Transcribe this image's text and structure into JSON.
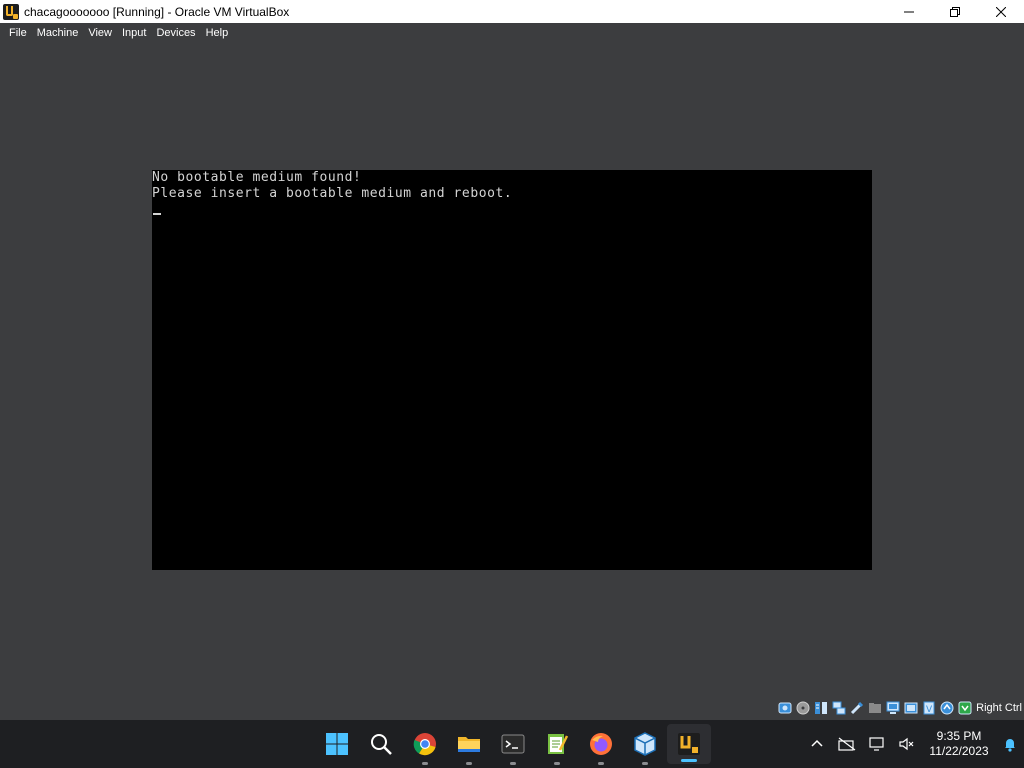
{
  "window": {
    "title": "chacagooooooo [Running] - Oracle VM VirtualBox"
  },
  "menu": {
    "items": [
      {
        "label": "File"
      },
      {
        "label": "Machine"
      },
      {
        "label": "View"
      },
      {
        "label": "Input"
      },
      {
        "label": "Devices"
      },
      {
        "label": "Help"
      }
    ]
  },
  "vm_screen": {
    "line1": "No bootable medium found!",
    "line2": "Please insert a bootable medium and reboot."
  },
  "statusbar": {
    "host_key": "Right Ctrl",
    "icons": [
      "hard-disk-icon",
      "optical-drive-icon",
      "audio-icon",
      "network-icon",
      "usb-icon",
      "shared-folders-icon",
      "display-icon",
      "recording-icon",
      "cpu-icon",
      "mouse-integration-icon",
      "keyboard-icon"
    ]
  },
  "taskbar": {
    "apps": [
      "start-icon",
      "search-icon",
      "chrome-icon",
      "file-explorer-icon",
      "terminal-icon",
      "notepad-icon",
      "firefox-icon",
      "virtualbox-icon",
      "virtualbox-vm-icon"
    ],
    "active_app": "virtualbox-vm-icon"
  },
  "tray": {
    "time": "9:35 PM",
    "date": "11/22/2023"
  },
  "colors": {
    "background": "#3c3d3f",
    "vm_screen": "#000000",
    "vm_text": "#d4d4d4",
    "taskbar": "#1e1f22",
    "accent": "#4cc2ff"
  }
}
